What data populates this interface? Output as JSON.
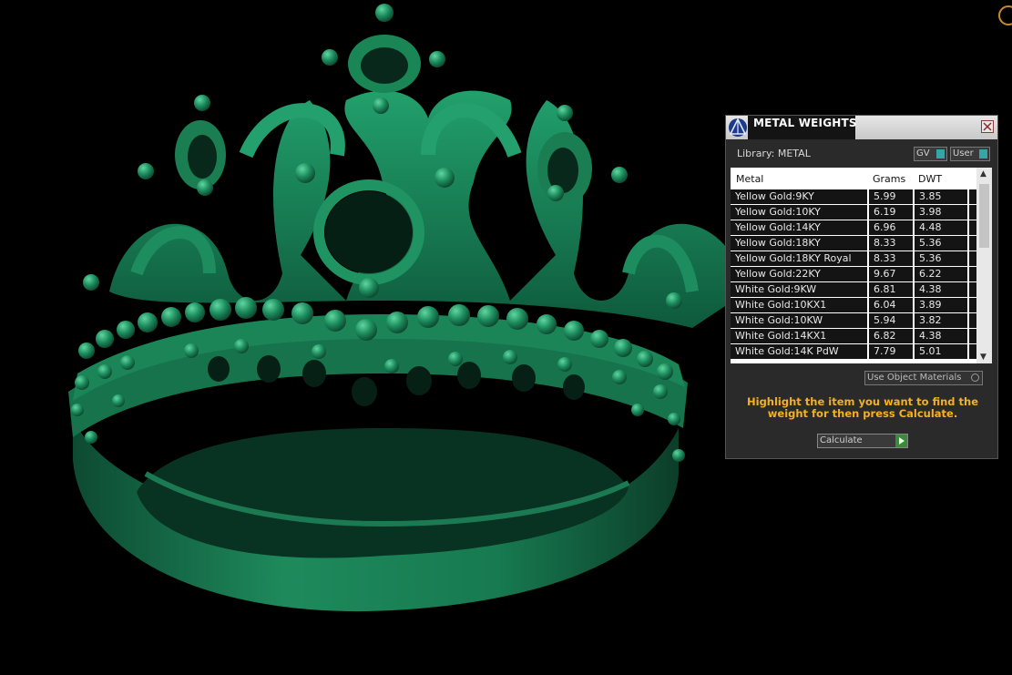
{
  "panel": {
    "title": "METAL WEIGHTS",
    "library_label": "Library: METAL",
    "toggle_gv": "GV",
    "toggle_user": "User",
    "columns": [
      "Metal",
      "Grams",
      "DWT"
    ],
    "rows": [
      {
        "metal": "Yellow Gold:9KY",
        "grams": "5.99",
        "dwt": "3.85"
      },
      {
        "metal": "Yellow Gold:10KY",
        "grams": "6.19",
        "dwt": "3.98"
      },
      {
        "metal": "Yellow Gold:14KY",
        "grams": "6.96",
        "dwt": "4.48"
      },
      {
        "metal": "Yellow Gold:18KY",
        "grams": "8.33",
        "dwt": "5.36"
      },
      {
        "metal": "Yellow Gold:18KY Royal",
        "grams": "8.33",
        "dwt": "5.36"
      },
      {
        "metal": "Yellow Gold:22KY",
        "grams": "9.67",
        "dwt": "6.22"
      },
      {
        "metal": "White Gold:9KW",
        "grams": "6.81",
        "dwt": "4.38"
      },
      {
        "metal": "White Gold:10KX1",
        "grams": "6.04",
        "dwt": "3.89"
      },
      {
        "metal": "White Gold:10KW",
        "grams": "5.94",
        "dwt": "3.82"
      },
      {
        "metal": "White Gold:14KX1",
        "grams": "6.82",
        "dwt": "4.38"
      },
      {
        "metal": "White Gold:14K PdW",
        "grams": "7.79",
        "dwt": "5.01"
      }
    ],
    "use_object_materials": "Use Object Materials",
    "instruction": "Highlight the item you want to find the weight for then press Calculate.",
    "calculate_label": "Calculate"
  },
  "colors": {
    "ring_green": "#1f8a5e",
    "instruction_text": "#f4b023",
    "panel_bg": "#2a2a2a"
  }
}
